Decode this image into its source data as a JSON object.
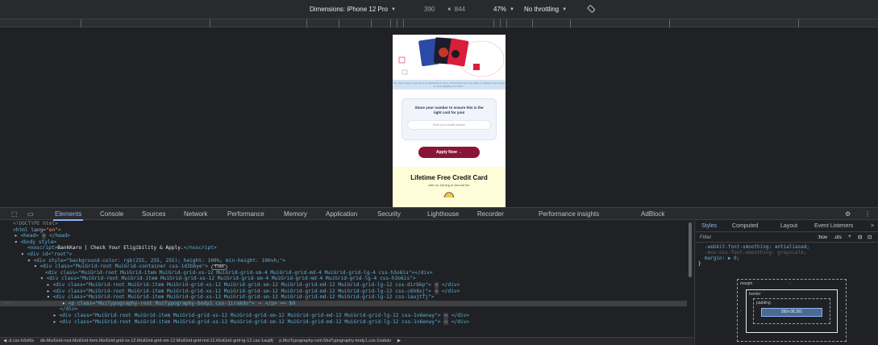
{
  "device_toolbar": {
    "dimensions_label": "Dimensions: iPhone 12 Pro",
    "width": "390",
    "times": "×",
    "height": "844",
    "zoom": "47%",
    "throttle": "No throttling"
  },
  "page": {
    "notice": "The card image on the site is for illustrative purpose. the actual image may differ if a different card based on your eligibility and credit...",
    "form_heading": "Share your number to ensure this is the right card for you!",
    "mobile_placeholder": "Enter your mobile number",
    "apply_label": "Apply Now →",
    "promo_title": "Lifetime Free Credit Card",
    "promo_subtitle": "with no Joining or Annual fee"
  },
  "devtools_tabs": [
    "Elements",
    "Console",
    "Sources",
    "Network",
    "Performance",
    "Memory",
    "Application",
    "Security",
    "Lighthouse",
    "Recorder",
    "Performance insights",
    "AdBlock"
  ],
  "elements": {
    "doctype": "<!DOCTYPE html>",
    "html_open_tag": "<html",
    "html_lang_attr": " lang=",
    "html_lang_val": "\"en\"",
    "head_line": "<head>",
    "head_close": "</head>",
    "body_line": "<body style>",
    "noscript": "BankKaro | Check Your Eligibility & Apply.",
    "root_div": "<div id=\"root\">",
    "style_div": "<div style=\"background-color: rgb(255, 255, 255); height: 100%; min-height: 100vh;\">",
    "container_div": "<div class=\"MuiGrid-root MuiGrid-container css-1d3bbye\">",
    "flex_badge": "flex",
    "rows": [
      "<div class=\"MuiGrid-root MuiGrid-item MuiGrid-grid-xs-12 MuiGrid-grid-sm-4 MuiGrid-grid-md-4 MuiGrid-grid-lg-4 css-h3o6is\"></div>",
      "<div class=\"MuiGrid-root MuiGrid-item MuiGrid-grid-xs-12 MuiGrid-grid-sm-4 MuiGrid-grid-md-4 MuiGrid-grid-lg-4 css-h3o6is\">",
      "<div class=\"MuiGrid-root MuiGrid-item MuiGrid-grid-xs-12 MuiGrid-grid-sm-12 MuiGrid-grid-md-12 MuiGrid-grid-lg-12 css-dirbkp\">",
      "<div class=\"MuiGrid-root MuiGrid-item MuiGrid-grid-xs-12 MuiGrid-grid-sm-12 MuiGrid-grid-md-12 MuiGrid-grid-lg-12 css-c6h8xj\">",
      "<div class=\"MuiGrid-root MuiGrid-item MuiGrid-grid-xs-12 MuiGrid-grid-sm-12 MuiGrid-grid-md-12 MuiGrid-grid-lg-12 css-1aujtfj\">"
    ],
    "selected_row": "<p class=\"MuiTypography-root MuiTypography-body1 css-1irakdo\">",
    "selected_suffix": "</p> == $0",
    "close_div": "</div>",
    "row_after_1": "<div class=\"MuiGrid-root MuiGrid-item MuiGrid-grid-xs-12 MuiGrid-grid-sm-12 MuiGrid-grid-md-12 MuiGrid-grid-lg-12 css-1v6enwy\">",
    "row_after_2": "<div class=\"MuiGrid-root MuiGrid-item MuiGrid-grid-xs-12 MuiGrid-grid-sm-12 MuiGrid-grid-md-12 MuiGrid-grid-lg-12 css-1v6enwy\">"
  },
  "breadcrumbs": [
    "◀ .d.css-h3o6is",
    "div.MuiGrid-root.MuiGrid-item.MuiGrid-grid-xs-12.MuiGrid-grid-sm-12.MuiGrid-grid-md-12.MuiGrid-grid-lg-12.css-1aujtfj",
    "p.MuiTypography-root.MuiTypography-body1.css-1irakdo",
    "▶"
  ],
  "styles_panel": {
    "tabs": [
      "Styles",
      "Computed",
      "Layout",
      "Event Listeners",
      ">"
    ],
    "filter_placeholder": "Filter",
    "hov": ":hov",
    "cls": ".cls",
    "css_lines": [
      "-webkit-font-smoothing: antialiased;",
      "-moz-osx-font-smoothing: grayscale;",
      "margin: ▶ 0;",
      "}"
    ],
    "box_margin": "margin",
    "box_border": "border",
    "box_padding": "padding",
    "box_content": "390×38.391",
    "dash": "-"
  }
}
